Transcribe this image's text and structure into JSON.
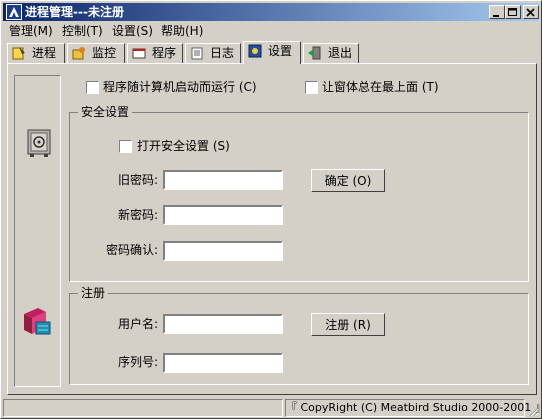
{
  "window": {
    "title": "进程管理---未注册"
  },
  "menu": [
    "管理(M)",
    "控制(T)",
    "设置(S)",
    "帮助(H)"
  ],
  "tabs": [
    "进程",
    "监控",
    "程序",
    "日志",
    "设置",
    "退出"
  ],
  "options": {
    "autostart_label": "程序随计算机启动而运行 (C)",
    "topmost_label": "让窗体总在最上面 (T)"
  },
  "security": {
    "group_title": "安全设置",
    "enable_label": "打开安全设置 (S)",
    "old_password_label": "旧密码:",
    "new_password_label": "新密码:",
    "confirm_password_label": "密码确认:",
    "ok_button": "确定 (O)"
  },
  "register": {
    "group_title": "注册",
    "username_label": "用户名:",
    "serial_label": "序列号:",
    "register_button": "注册 (R)"
  },
  "status": {
    "copyright": "『  CopyRight (C) Meatbird Studio 2000-2001  』"
  },
  "colors": {
    "title_start": "#0a246a",
    "title_end": "#a6caf0",
    "face": "#d4d0c8"
  }
}
